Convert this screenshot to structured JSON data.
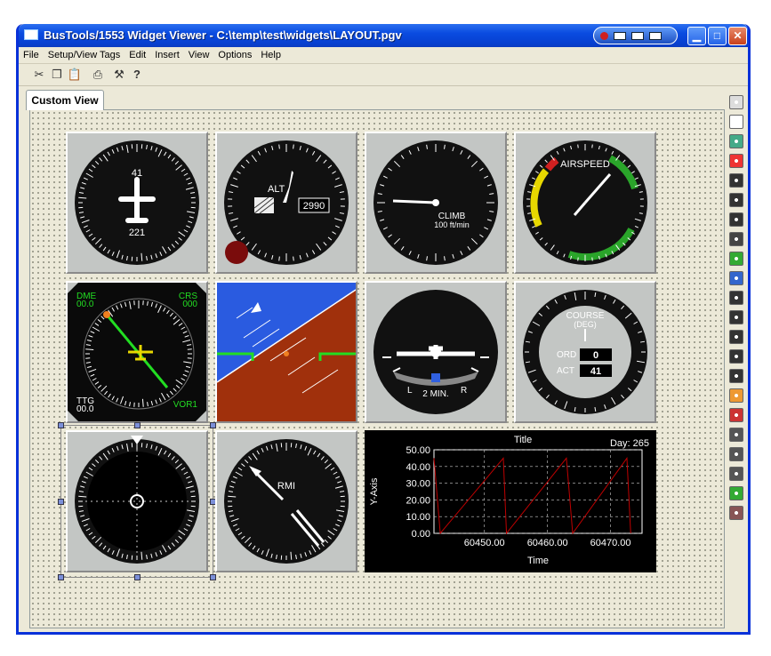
{
  "window": {
    "title": "BusTools/1553 Widget Viewer - C:\\temp\\test\\widgets\\LAYOUT.pgv"
  },
  "menu": [
    "File",
    "Setup/View Tags",
    "Edit",
    "Insert",
    "View",
    "Options",
    "Help"
  ],
  "tab": {
    "label": "Custom View"
  },
  "palette_icons": [
    "text-label-icon",
    "blank-icon",
    "image-icon",
    "compass-icon",
    "gauge-icon",
    "gauge-icon",
    "gauge-icon",
    "gauge-icon",
    "attitude-icon",
    "horizon-icon",
    "gauge-icon",
    "gauge-icon",
    "gauge-icon",
    "gauge-icon",
    "gauge-icon",
    "arc-gauge-icon",
    "dial-icon",
    "table-icon",
    "table-icon",
    "grid-icon",
    "chart-icon",
    "chart-icon"
  ],
  "widgets": {
    "heading": {
      "top": "41",
      "bottom": "221"
    },
    "altimeter": {
      "label": "ALT",
      "readout": "2990"
    },
    "vsi": {
      "label": "CLIMB",
      "units": "100 ft/min"
    },
    "airspeed": {
      "label": "AIRSPEED"
    },
    "hsi": {
      "dme_label": "DME",
      "dme_value": "00.0",
      "crs_label": "CRS",
      "crs_value": "000",
      "ttg_label": "TTG",
      "ttg_value": "00.0",
      "nav_label": "VOR1"
    },
    "turn": {
      "left": "L",
      "right": "R",
      "label": "2 MIN."
    },
    "course": {
      "title": "COURSE",
      "units": "(DEG)",
      "ord_label": "ORD",
      "ord_value": "0",
      "act_label": "ACT",
      "act_value": "41"
    },
    "rmi": {
      "label": "RMI"
    }
  },
  "chart_data": {
    "type": "line",
    "title": "Title",
    "annotation": "Day: 265",
    "xlabel": "Time",
    "ylabel": "Y-Axis",
    "xlim": [
      60442,
      60475
    ],
    "ylim": [
      0,
      50
    ],
    "x_ticks": [
      "60450.00",
      "60460.00",
      "60470.00"
    ],
    "y_ticks": [
      "50.00",
      "40.00",
      "30.00",
      "20.00",
      "10.00",
      "0.00"
    ],
    "series": [
      {
        "x": [
          60442,
          60443,
          60453,
          60453.5,
          60463,
          60464,
          60472.6,
          60473.2
        ],
        "y": [
          45,
          0,
          45,
          0,
          45,
          0,
          45,
          0
        ]
      }
    ],
    "colors": {
      "background": "#000000",
      "line": "#c00000",
      "grid": "#cccccc"
    }
  }
}
